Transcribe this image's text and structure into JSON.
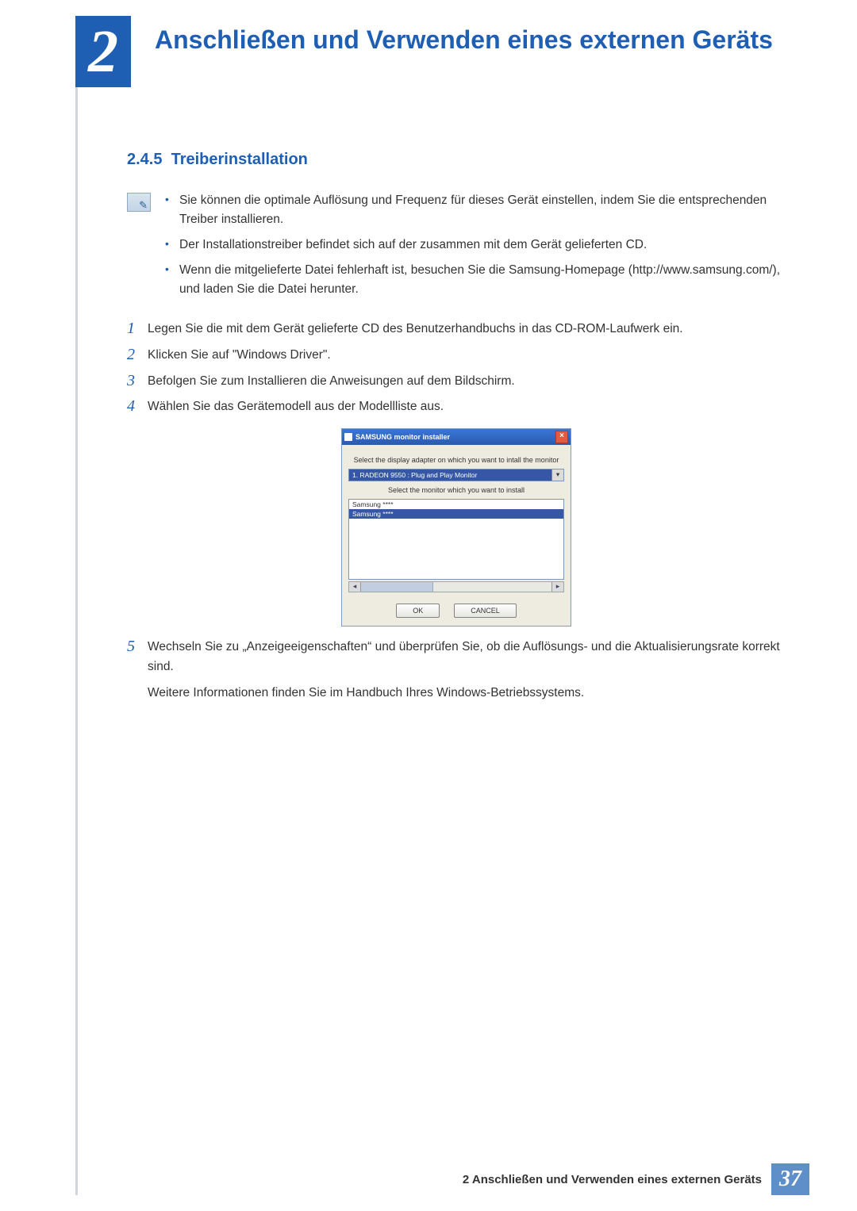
{
  "chapter": {
    "number": "2",
    "title": "Anschließen und Verwenden eines externen Geräts"
  },
  "section": {
    "number": "2.4.5",
    "title": "Treiberinstallation"
  },
  "notes": [
    "Sie können die optimale Auflösung und Frequenz für dieses Gerät einstellen, indem Sie die entsprechenden Treiber installieren.",
    "Der Installationstreiber befindet sich auf der zusammen mit dem Gerät gelieferten CD.",
    "Wenn die mitgelieferte Datei fehlerhaft ist, besuchen Sie die Samsung-Homepage (http://www.samsung.com/), und laden Sie die Datei herunter."
  ],
  "steps": [
    {
      "n": "1",
      "text": "Legen Sie die mit dem Gerät gelieferte CD des Benutzerhandbuchs in das CD-ROM-Laufwerk ein."
    },
    {
      "n": "2",
      "text": "Klicken Sie auf \"Windows Driver\"."
    },
    {
      "n": "3",
      "text": "Befolgen Sie zum Installieren die Anweisungen auf dem Bildschirm."
    },
    {
      "n": "4",
      "text": "Wählen Sie das Gerätemodell aus der Modellliste aus."
    },
    {
      "n": "5",
      "text": "Wechseln Sie zu „Anzeigeeigenschaften“ und überprüfen Sie, ob die Auflösungs- und die Aktualisierungsrate korrekt sind."
    }
  ],
  "step5_extra": "Weitere Informationen finden Sie im Handbuch Ihres Windows-Betriebssystems.",
  "installer": {
    "title": "SAMSUNG monitor installer",
    "label1": "Select the display adapter on which you want to intall the monitor",
    "select_value": "1. RADEON 9550 : Plug and Play Monitor",
    "label2": "Select the monitor which you want to install",
    "list_items": [
      "Samsung ****",
      "Samsung ****"
    ],
    "ok": "OK",
    "cancel": "CANCEL"
  },
  "footer": {
    "text": "2 Anschließen und Verwenden eines externen Geräts",
    "page": "37"
  }
}
